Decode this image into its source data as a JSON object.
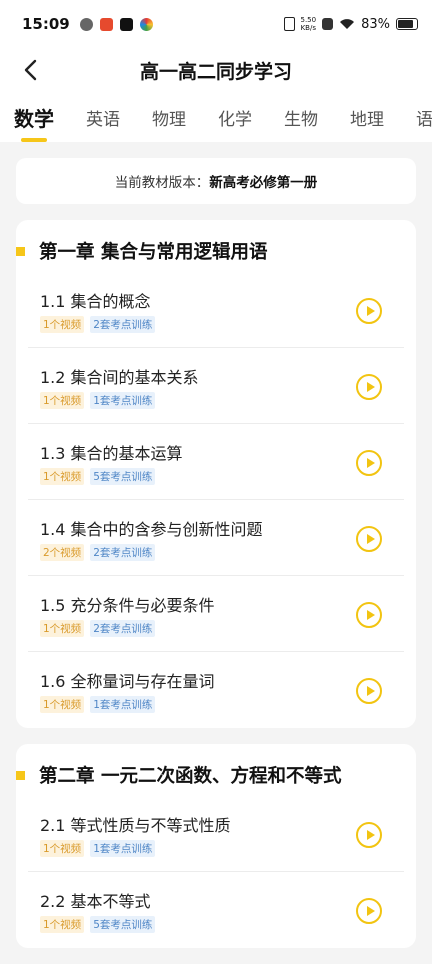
{
  "status": {
    "time": "15:09",
    "net_speed": "5.50\nKB/s",
    "battery": "83%"
  },
  "header": {
    "title": "高一高二同步学习"
  },
  "tabs": [
    {
      "label": "数学"
    },
    {
      "label": "英语"
    },
    {
      "label": "物理"
    },
    {
      "label": "化学"
    },
    {
      "label": "生物"
    },
    {
      "label": "地理"
    },
    {
      "label": "语文"
    }
  ],
  "version": {
    "label": "当前教材版本：",
    "value": "新高考必修第一册"
  },
  "chapters": [
    {
      "title": "第一章 集合与常用逻辑用语",
      "lessons": [
        {
          "title": "1.1 集合的概念",
          "video": "1个视频",
          "train": "2套考点训练"
        },
        {
          "title": "1.2 集合间的基本关系",
          "video": "1个视频",
          "train": "1套考点训练"
        },
        {
          "title": "1.3 集合的基本运算",
          "video": "1个视频",
          "train": "5套考点训练"
        },
        {
          "title": "1.4 集合中的含参与创新性问题",
          "video": "2个视频",
          "train": "2套考点训练"
        },
        {
          "title": "1.5 充分条件与必要条件",
          "video": "1个视频",
          "train": "2套考点训练"
        },
        {
          "title": "1.6 全称量词与存在量词",
          "video": "1个视频",
          "train": "1套考点训练"
        }
      ]
    },
    {
      "title": "第二章 一元二次函数、方程和不等式",
      "lessons": [
        {
          "title": "2.1 等式性质与不等式性质",
          "video": "1个视频",
          "train": "1套考点训练"
        },
        {
          "title": "2.2 基本不等式",
          "video": "1个视频",
          "train": "5套考点训练"
        }
      ]
    }
  ],
  "colors": {
    "accent": "#f6c619",
    "play": "#f2c411"
  }
}
